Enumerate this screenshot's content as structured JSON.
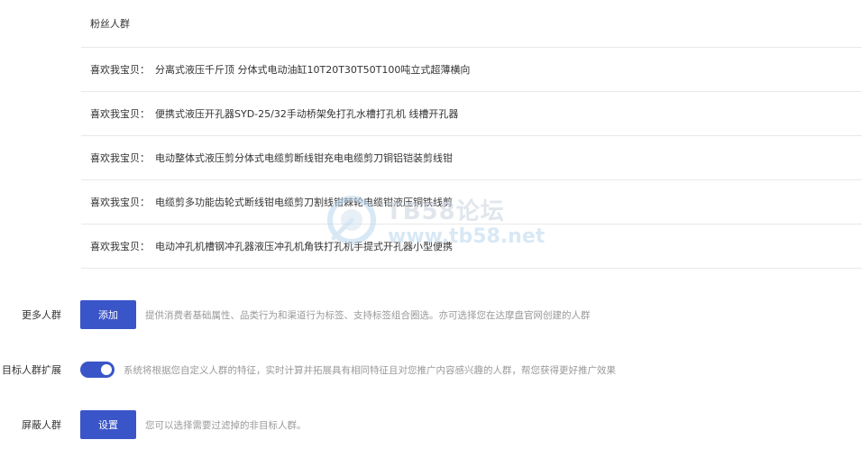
{
  "crowd_list": {
    "header": "粉丝人群",
    "items": [
      {
        "prefix": "喜欢我宝贝：",
        "title": "分离式液压千斤顶 分体式电动油缸10T20T30T50T100吨立式超薄横向"
      },
      {
        "prefix": "喜欢我宝贝：",
        "title": "便携式液压开孔器SYD-25/32手动桥架免打孔水槽打孔机 线槽开孔器"
      },
      {
        "prefix": "喜欢我宝贝：",
        "title": "电动整体式液压剪分体式电缆剪断线钳充电电缆剪刀铜铝铠装剪线钳"
      },
      {
        "prefix": "喜欢我宝贝：",
        "title": "电缆剪多功能齿轮式断线钳电缆剪刀割线钳棘轮电缆钳液压铜铁线剪"
      },
      {
        "prefix": "喜欢我宝贝：",
        "title": "电动冲孔机槽钢冲孔器液压冲孔机角铁打孔机手提式开孔器小型便携"
      }
    ]
  },
  "more_crowds": {
    "label": "更多人群",
    "button": "添加",
    "hint": "提供消费者基础属性、品类行为和渠道行为标签、支持标签组合圈选。亦可选择您在达摩盘官网创建的人群"
  },
  "target_expand": {
    "label": "目标人群扩展",
    "enabled": true,
    "hint": "系统将根据您自定义人群的特征，实时计算并拓展具有相同特征且对您推广内容感兴趣的人群，帮您获得更好推广效果"
  },
  "block_crowds": {
    "label": "屏蔽人群",
    "button": "设置",
    "hint": "您可以选择需要过滤掉的非目标人群。"
  },
  "watermark": {
    "title": "TB58论坛",
    "url": "www.tb58.net"
  },
  "colors": {
    "primary": "#3a55c8",
    "hint": "#999999",
    "divider": "#e8e8e8"
  }
}
